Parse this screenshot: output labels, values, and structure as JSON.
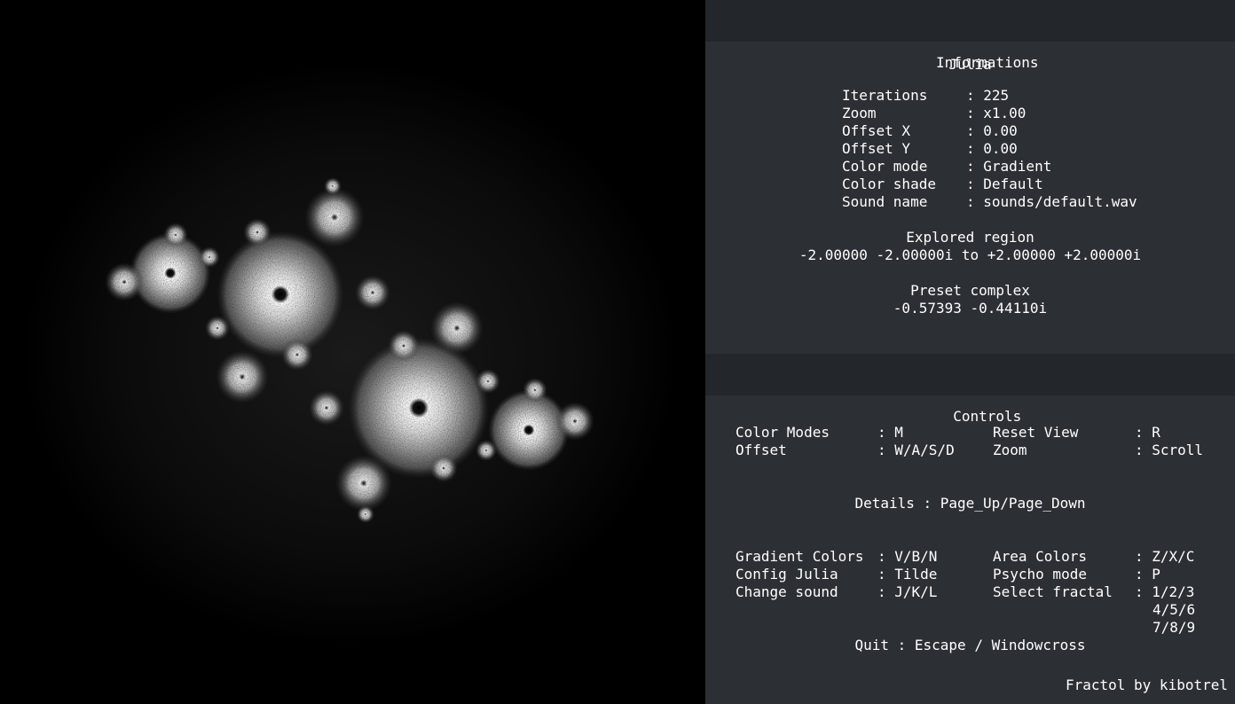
{
  "info": {
    "header": "Informations",
    "fractal_name": "Julia",
    "rows": [
      {
        "label": "Iterations",
        "value": "225"
      },
      {
        "label": "Zoom",
        "value": "x1.00"
      },
      {
        "label": "Offset X",
        "value": "0.00"
      },
      {
        "label": "Offset Y",
        "value": "0.00"
      },
      {
        "label": "Color mode",
        "value": "Gradient"
      },
      {
        "label": "Color shade",
        "value": "Default"
      },
      {
        "label": "Sound name",
        "value": "sounds/default.wav"
      }
    ],
    "region_title": "Explored region",
    "region_value": "-2.00000 -2.00000i to +2.00000 +2.00000i",
    "preset_title": "Preset complex",
    "preset_value": "-0.57393 -0.44110i"
  },
  "controls": {
    "header": "Controls",
    "row1": [
      {
        "label": "Color Modes",
        "key": "M"
      },
      {
        "label": "Reset View",
        "key": "R"
      }
    ],
    "row2": [
      {
        "label": "Offset",
        "key": "W/A/S/D"
      },
      {
        "label": "Zoom",
        "key": "Scroll"
      }
    ],
    "details": "Details : Page_Up/Page_Down",
    "row3": [
      {
        "label": "Gradient Colors",
        "key": "V/B/N"
      },
      {
        "label": "Area Colors",
        "key": "Z/X/C"
      }
    ],
    "row4": [
      {
        "label": "Config Julia",
        "key": "Tilde"
      },
      {
        "label": "Psycho mode",
        "key": "P"
      }
    ],
    "row5": [
      {
        "label": "Change sound",
        "key": "J/K/L"
      },
      {
        "label": "Select fractal",
        "key": "1/2/3"
      }
    ],
    "select_more": [
      "4/5/6",
      "7/8/9"
    ],
    "quit": "Quit : Escape / Windowcross"
  },
  "footer": "Fractol by kibotrel",
  "colors": {
    "panel_bg": "#2c2f33",
    "header_bg": "#23262a",
    "canvas_bg": "#000000",
    "text": "#ffffff"
  }
}
